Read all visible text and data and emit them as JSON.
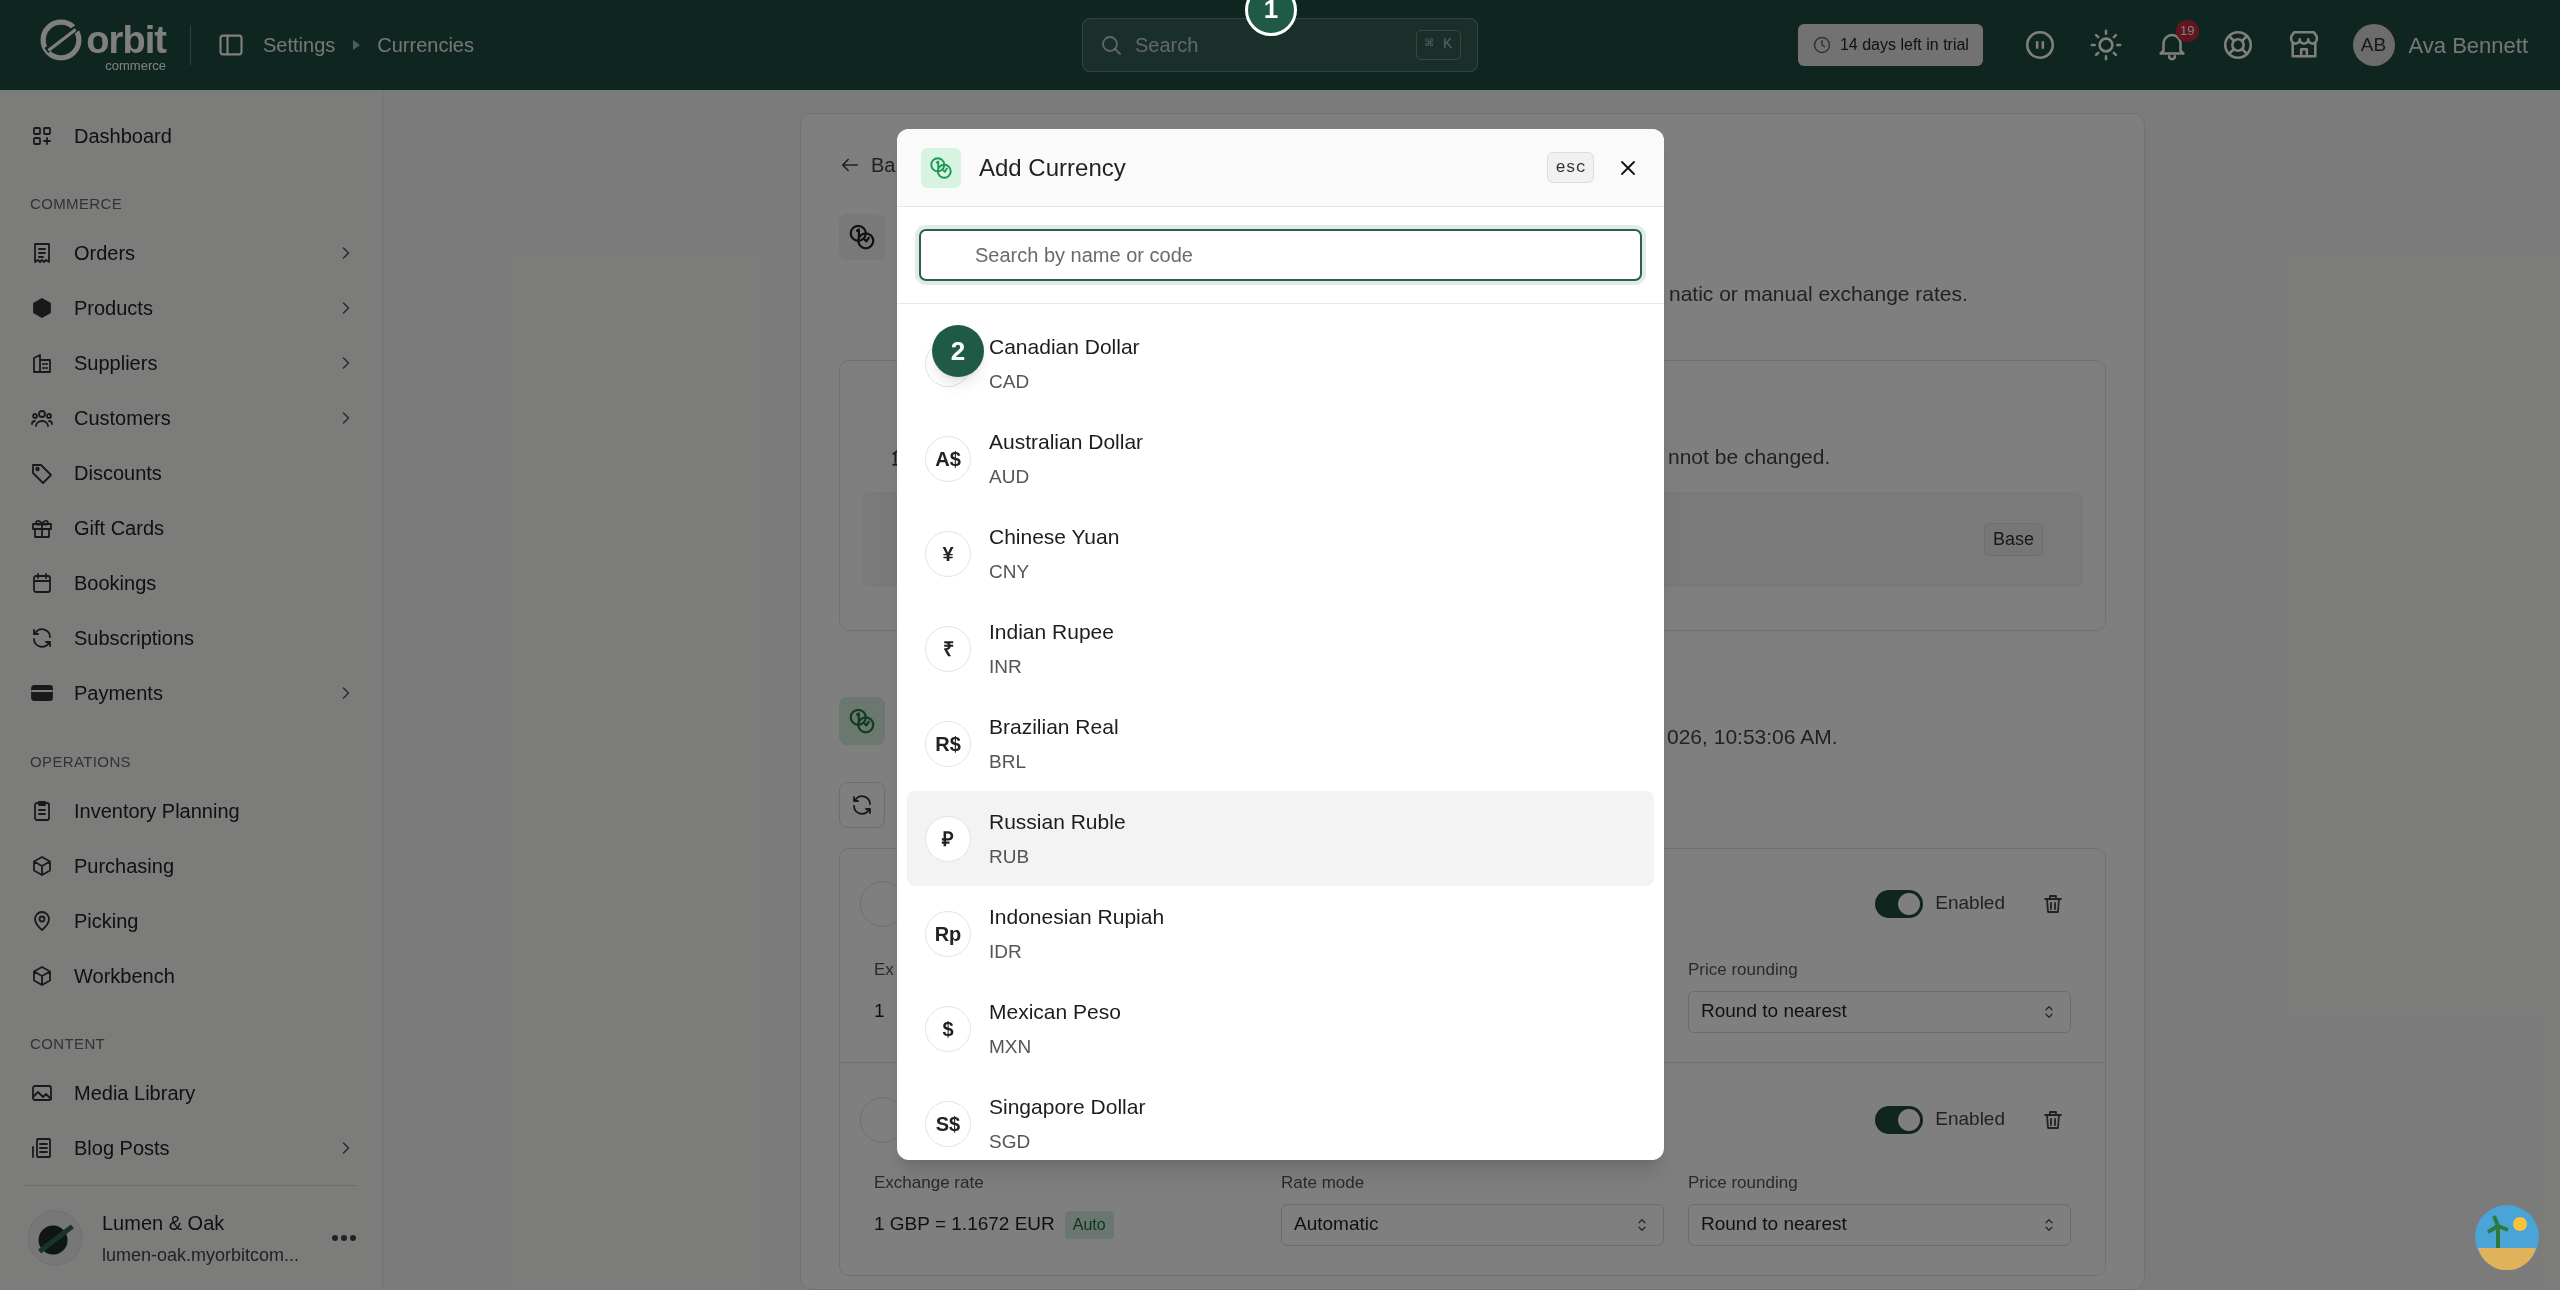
{
  "topbar": {
    "logo": {
      "name": "orbit",
      "tagline": "commerce"
    },
    "breadcrumb": [
      "Settings",
      "Currencies"
    ],
    "search": {
      "placeholder": "Search",
      "shortcut": "⌘ K"
    },
    "trial_badge": "14 days left in trial",
    "notifications_count": "19",
    "user": {
      "initials": "AB",
      "name": "Ava Bennett"
    }
  },
  "sidebar": {
    "sections": [
      {
        "items": [
          {
            "label": "Dashboard",
            "has_submenu": false
          }
        ]
      },
      {
        "heading": "COMMERCE",
        "items": [
          {
            "label": "Orders",
            "has_submenu": true
          },
          {
            "label": "Products",
            "has_submenu": true
          },
          {
            "label": "Suppliers",
            "has_submenu": true
          },
          {
            "label": "Customers",
            "has_submenu": true
          },
          {
            "label": "Discounts",
            "has_submenu": false
          },
          {
            "label": "Gift Cards",
            "has_submenu": false
          },
          {
            "label": "Bookings",
            "has_submenu": false
          },
          {
            "label": "Subscriptions",
            "has_submenu": false
          },
          {
            "label": "Payments",
            "has_submenu": true
          }
        ]
      },
      {
        "heading": "OPERATIONS",
        "items": [
          {
            "label": "Inventory Planning",
            "has_submenu": false
          },
          {
            "label": "Purchasing",
            "has_submenu": false
          },
          {
            "label": "Picking",
            "has_submenu": false
          },
          {
            "label": "Workbench",
            "has_submenu": false
          }
        ]
      },
      {
        "heading": "CONTENT",
        "items": [
          {
            "label": "Media Library",
            "has_submenu": false
          },
          {
            "label": "Blog Posts",
            "has_submenu": true
          }
        ]
      }
    ],
    "store": {
      "name": "Lumen & Oak",
      "url": "lumen-oak.myorbitcom..."
    }
  },
  "page": {
    "back_link": "Ba",
    "description_fragment": "natic or manual exchange rates.",
    "base_card": {
      "note_fragment": "nnot be changed.",
      "badge": "Base"
    },
    "rates_fragment": "026, 10:53:06 AM.",
    "currency_rows": [
      {
        "enabled": true,
        "toggle_label": "Enabled",
        "rate_label": "Ex",
        "rate_value": "1",
        "rounding_label": "Price rounding",
        "rounding_value": "Round to nearest"
      },
      {
        "enabled": true,
        "toggle_label": "Enabled",
        "rate_label": "Exchange rate",
        "rate_value": "1 GBP = 1.1672 EUR",
        "rate_badge": "Auto",
        "mode_label": "Rate mode",
        "mode_value": "Automatic",
        "rounding_label": "Price rounding",
        "rounding_value": "Round to nearest"
      }
    ]
  },
  "modal": {
    "title": "Add Currency",
    "esc_hint": "esc",
    "search": {
      "placeholder": "Search by name or code"
    },
    "currencies": [
      {
        "name": "Canadian Dollar",
        "code": "CAD",
        "highlighted": false
      },
      {
        "symbol": "A$",
        "name": "Australian Dollar",
        "code": "AUD",
        "highlighted": false
      },
      {
        "symbol": "¥",
        "name": "Chinese Yuan",
        "code": "CNY",
        "highlighted": false
      },
      {
        "symbol": "₹",
        "name": "Indian Rupee",
        "code": "INR",
        "highlighted": false
      },
      {
        "symbol": "R$",
        "name": "Brazilian Real",
        "code": "BRL",
        "highlighted": false
      },
      {
        "symbol": "₽",
        "name": "Russian Ruble",
        "code": "RUB",
        "highlighted": true
      },
      {
        "symbol": "Rp",
        "name": "Indonesian Rupiah",
        "code": "IDR",
        "highlighted": false
      },
      {
        "symbol": "$",
        "name": "Mexican Peso",
        "code": "MXN",
        "highlighted": false
      },
      {
        "symbol": "S$",
        "name": "Singapore Dollar",
        "code": "SGD",
        "highlighted": false
      }
    ]
  },
  "step_markers": [
    {
      "label": "1"
    },
    {
      "label": "2"
    }
  ]
}
